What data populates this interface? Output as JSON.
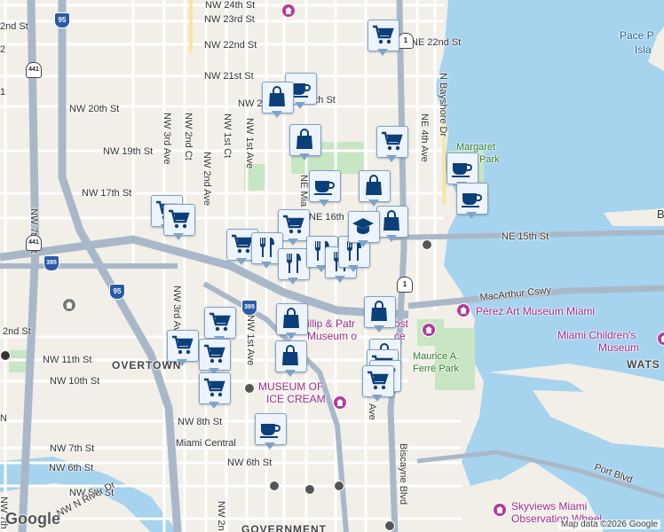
{
  "streets": {
    "nw24": "NW 24th St",
    "nw23": "NW 23rd St",
    "nw22": "NW 22nd St",
    "ne22": "NE 22nd St",
    "nw21": "NW 21st St",
    "nw20": "NW 20th St",
    "nw20b": "NW 20th",
    "st20": "20th St",
    "nw19": "NW 19th St",
    "nw17": "NW 17th St",
    "ne16": "NE 16th",
    "ne15": "NE 15th St",
    "nw11": "NW 11th St",
    "nw10": "NW 10th St",
    "nw8": "NW 8th St",
    "nw7": "NW 7th St",
    "nw6a": "NW 6th St",
    "nw6b": "NW 6th St",
    "nw5": "NW 5th St",
    "nwriver": "NW N River Dr",
    "n2": "2nd St",
    "s2": "2nd St",
    "nw7ave": "NW 7th Ct",
    "nw3ave": "NW 3rd Ave",
    "nw2ct": "NW 2nd Ct",
    "nw2ave": "NW 2nd Ave",
    "nw1ct": "NW 1st Ct",
    "nw1ave": "NW 1st Ave",
    "nw3ave2": "NW 3rd Ave",
    "nw1ave2": "NW 1st Ave",
    "nemia": "NE Mia",
    "ne4": "NE 4th Ave",
    "nbay": "N Bayshore Dr",
    "biscayne": "Biscayne Blvd",
    "nw2nd": "NW 2n",
    "ave": "Ave",
    "macarthur": "MacArthur Cswy",
    "portblvd": "Port Blvd",
    "government": "GOVERNMENT",
    "nw7th": "NW 7th"
  },
  "places": {
    "overtown": "OVERTOWN",
    "watson": "WATS",
    "pacep": "Pace P",
    "island": "Isla",
    "margaret": "Margaret",
    "park": "Park",
    "perez": "Pérez Art Museum Miami",
    "childrens1": "Miami Children's",
    "childrens2": "Museum",
    "ferre1": "Maurice A.",
    "ferre2": "Ferré Park",
    "museum1": "MUSEUM OF",
    "museum2": "ICE CREAM",
    "phillip1": "illip & Patr",
    "phillip2": "ost",
    "phillip3": "Museum o",
    "phillip4": "ce",
    "skyviews1": "Skyviews Miami",
    "skyviews2": "Observation Wheel",
    "central": "Miami Central",
    "left_n": "N",
    "left_2": "2",
    "left_1": "1",
    "right_b": "B"
  },
  "shields": {
    "i95a": "95",
    "i95b": "95",
    "i395": "395",
    "us441a": "441",
    "us441b": "441",
    "us1": "1",
    "us1b": "1"
  },
  "markers": [
    {
      "type": "cart"
    },
    {
      "type": "coffee"
    },
    {
      "type": "bag"
    },
    {
      "type": "bag"
    },
    {
      "type": "cart"
    },
    {
      "type": "coffee"
    },
    {
      "type": "coffee"
    },
    {
      "type": "coffee"
    },
    {
      "type": "bag"
    },
    {
      "type": "bag"
    },
    {
      "type": "cart"
    },
    {
      "type": "cart"
    },
    {
      "type": "cart"
    },
    {
      "type": "cart"
    },
    {
      "type": "fork"
    },
    {
      "type": "fork"
    },
    {
      "type": "fork"
    },
    {
      "type": "fork"
    },
    {
      "type": "fork"
    },
    {
      "type": "school"
    },
    {
      "type": "bag"
    },
    {
      "type": "cart"
    },
    {
      "type": "cart"
    },
    {
      "type": "bag"
    },
    {
      "type": "bag"
    },
    {
      "type": "cart"
    },
    {
      "type": "bag"
    },
    {
      "type": "cart"
    },
    {
      "type": "cart"
    },
    {
      "type": "cart"
    },
    {
      "type": "cart"
    },
    {
      "type": "coffee"
    }
  ],
  "logo": "Google",
  "attribution": "Map data ©2026 Google",
  "colors": {
    "water": "#a6d3ee",
    "land": "#f2efe9",
    "highway": "#a9b8c9",
    "park": "#c8e6c3",
    "marker_icon": "#0b3f7a"
  }
}
